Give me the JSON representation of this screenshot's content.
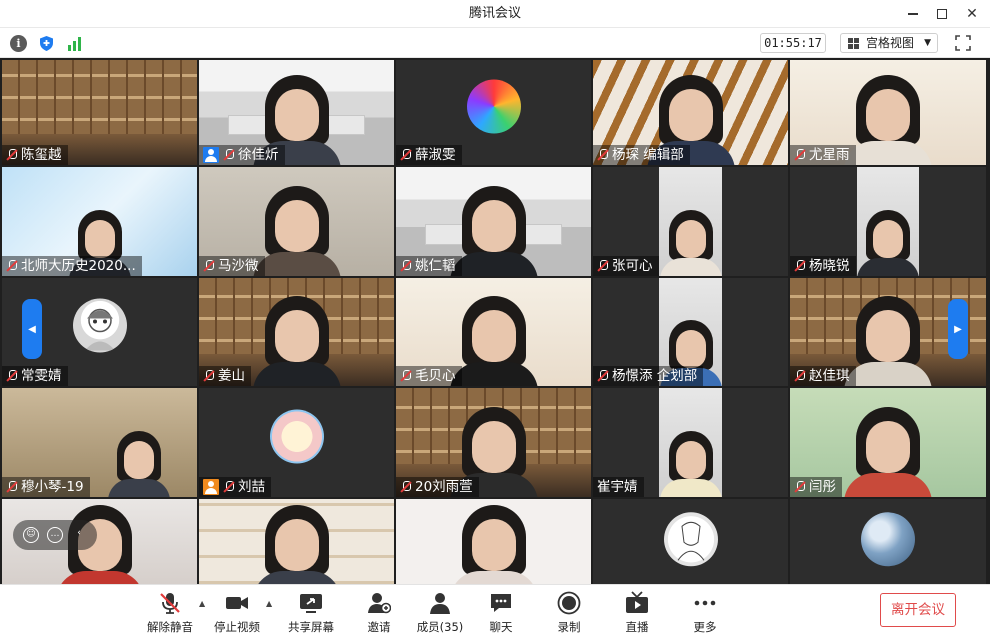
{
  "window": {
    "title": "腾讯会议"
  },
  "infobar": {
    "timer": "01:55:17",
    "view_mode": "宫格视图"
  },
  "tiles": [
    {
      "name": "陈玺越"
    },
    {
      "name": "徐佳炘"
    },
    {
      "name": "薛淑雯"
    },
    {
      "name": "杨琛 编辑部"
    },
    {
      "name": "尤星雨"
    },
    {
      "name": "北师大历史2020..."
    },
    {
      "name": "马沙微"
    },
    {
      "name": "姚仁韬"
    },
    {
      "name": "张可心"
    },
    {
      "name": "杨晓锐"
    },
    {
      "name": "常雯婧"
    },
    {
      "name": "姜山"
    },
    {
      "name": "毛贝心"
    },
    {
      "name": "杨憬添 企划部"
    },
    {
      "name": "赵佳琪"
    },
    {
      "name": "穆小琴-19"
    },
    {
      "name": "刘喆"
    },
    {
      "name": "20刘雨萱"
    },
    {
      "name": "崔宇婧"
    },
    {
      "name": "闫彤"
    },
    {
      "name": ""
    },
    {
      "name": ""
    },
    {
      "name": ""
    },
    {
      "name": ""
    },
    {
      "name": ""
    }
  ],
  "toolbar": {
    "unmute": "解除静音",
    "stop_video": "停止视频",
    "share_screen": "共享屏幕",
    "invite": "邀请",
    "members": "成员(35)",
    "chat": "聊天",
    "record": "录制",
    "live": "直播",
    "more": "更多",
    "leave": "离开会议"
  },
  "colors": {
    "accent_blue": "#1e7cf0",
    "leave_red": "#e04b4b",
    "mic_muted_red": "#e23b3b",
    "signal_green": "#2fb44a"
  }
}
